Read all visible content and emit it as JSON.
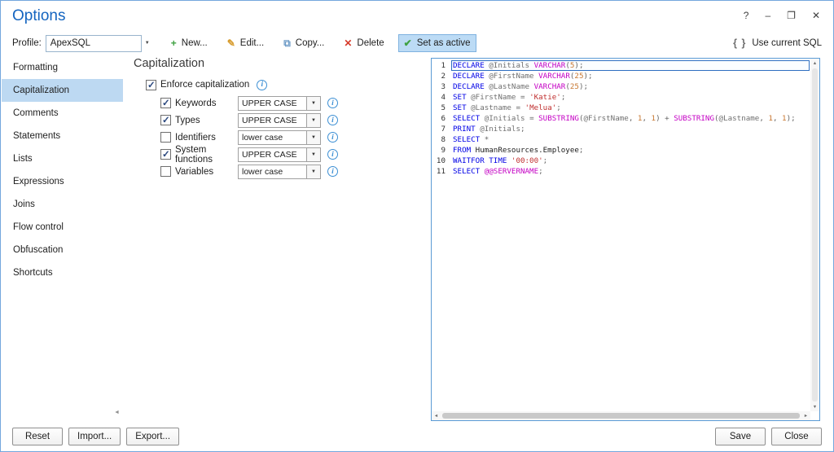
{
  "window": {
    "title": "Options"
  },
  "window_controls": [
    {
      "name": "help",
      "glyph": "?"
    },
    {
      "name": "minimize",
      "glyph": "–"
    },
    {
      "name": "maximize",
      "glyph": "❐"
    },
    {
      "name": "close",
      "glyph": "✕"
    }
  ],
  "icons": {
    "dropdown": "▼",
    "info": "i",
    "scroll_up": "▲",
    "scroll_down": "▼",
    "scroll_left": "◄",
    "scroll_right": "►"
  },
  "toolbar": {
    "profile_label": "Profile:",
    "profile_value": "ApexSQL",
    "buttons": [
      {
        "id": "new",
        "label": "New...",
        "icon": "plus-icon",
        "glyph": "+",
        "color": "#3fa142",
        "active": false
      },
      {
        "id": "edit",
        "label": "Edit...",
        "icon": "pencil-icon",
        "glyph": "✎",
        "color": "#d79b2c",
        "active": false
      },
      {
        "id": "copy",
        "label": "Copy...",
        "icon": "copy-icon",
        "glyph": "⧉",
        "color": "#6d9bc7",
        "active": false
      },
      {
        "id": "delete",
        "label": "Delete",
        "icon": "delete-x-icon",
        "glyph": "✕",
        "color": "#d63a2a",
        "active": false
      },
      {
        "id": "set-as-active",
        "label": "Set as active",
        "icon": "check-icon",
        "glyph": "✔",
        "color": "#3fa142",
        "active": true
      }
    ],
    "use_current_sql": {
      "glyph": "{ }",
      "label": "Use current SQL"
    }
  },
  "sidebar": {
    "items": [
      {
        "label": "Formatting",
        "selected": false
      },
      {
        "label": "Capitalization",
        "selected": true
      },
      {
        "label": "Comments",
        "selected": false
      },
      {
        "label": "Statements",
        "selected": false
      },
      {
        "label": "Lists",
        "selected": false
      },
      {
        "label": "Expressions",
        "selected": false
      },
      {
        "label": "Joins",
        "selected": false
      },
      {
        "label": "Flow control",
        "selected": false
      },
      {
        "label": "Obfuscation",
        "selected": false
      },
      {
        "label": "Shortcuts",
        "selected": false
      }
    ]
  },
  "main": {
    "title": "Capitalization",
    "enforce": {
      "label": "Enforce capitalization",
      "checked": true
    },
    "options": [
      {
        "label": "Keywords",
        "checked": true,
        "value": "UPPER CASE"
      },
      {
        "label": "Types",
        "checked": true,
        "value": "UPPER CASE"
      },
      {
        "label": "Identifiers",
        "checked": false,
        "value": "lower case"
      },
      {
        "label": "System functions",
        "checked": true,
        "value": "UPPER CASE"
      },
      {
        "label": "Variables",
        "checked": false,
        "value": "lower case"
      }
    ]
  },
  "preview": {
    "colors": {
      "keyword": "#0000e6",
      "function": "#c400c4",
      "string": "#c03030",
      "number": "#c87832",
      "variable": "#707070",
      "identifier": "#202020",
      "punct": "#666666"
    },
    "lines": [
      {
        "n": 1,
        "selected": true,
        "tokens": [
          {
            "t": "DECLARE ",
            "c": "k"
          },
          {
            "t": "@Initials ",
            "c": "v"
          },
          {
            "t": "VARCHAR",
            "c": "f"
          },
          {
            "t": "(",
            "c": "p"
          },
          {
            "t": "5",
            "c": "n"
          },
          {
            "t": ");",
            "c": "p"
          }
        ]
      },
      {
        "n": 2,
        "selected": false,
        "tokens": [
          {
            "t": "DECLARE ",
            "c": "k"
          },
          {
            "t": "@FirstName ",
            "c": "v"
          },
          {
            "t": "VARCHAR",
            "c": "f"
          },
          {
            "t": "(",
            "c": "p"
          },
          {
            "t": "25",
            "c": "n"
          },
          {
            "t": ");",
            "c": "p"
          }
        ]
      },
      {
        "n": 3,
        "selected": false,
        "tokens": [
          {
            "t": "DECLARE ",
            "c": "k"
          },
          {
            "t": "@LastName ",
            "c": "v"
          },
          {
            "t": "VARCHAR",
            "c": "f"
          },
          {
            "t": "(",
            "c": "p"
          },
          {
            "t": "25",
            "c": "n"
          },
          {
            "t": ");",
            "c": "p"
          }
        ]
      },
      {
        "n": 4,
        "selected": false,
        "tokens": [
          {
            "t": "SET ",
            "c": "k"
          },
          {
            "t": "@FirstName ",
            "c": "v"
          },
          {
            "t": "= ",
            "c": "p"
          },
          {
            "t": "'Katie'",
            "c": "s"
          },
          {
            "t": ";",
            "c": "p"
          }
        ]
      },
      {
        "n": 5,
        "selected": false,
        "tokens": [
          {
            "t": "SET ",
            "c": "k"
          },
          {
            "t": "@Lastname ",
            "c": "v"
          },
          {
            "t": "= ",
            "c": "p"
          },
          {
            "t": "'Melua'",
            "c": "s"
          },
          {
            "t": ";",
            "c": "p"
          }
        ]
      },
      {
        "n": 6,
        "selected": false,
        "tokens": [
          {
            "t": "SELECT ",
            "c": "k"
          },
          {
            "t": "@Initials ",
            "c": "v"
          },
          {
            "t": "= ",
            "c": "p"
          },
          {
            "t": "SUBSTRING",
            "c": "f"
          },
          {
            "t": "(",
            "c": "p"
          },
          {
            "t": "@FirstName",
            "c": "v"
          },
          {
            "t": ", ",
            "c": "p"
          },
          {
            "t": "1",
            "c": "n"
          },
          {
            "t": ", ",
            "c": "p"
          },
          {
            "t": "1",
            "c": "n"
          },
          {
            "t": ") + ",
            "c": "p"
          },
          {
            "t": "SUBSTRING",
            "c": "f"
          },
          {
            "t": "(",
            "c": "p"
          },
          {
            "t": "@Lastname",
            "c": "v"
          },
          {
            "t": ", ",
            "c": "p"
          },
          {
            "t": "1",
            "c": "n"
          },
          {
            "t": ", ",
            "c": "p"
          },
          {
            "t": "1",
            "c": "n"
          },
          {
            "t": ");",
            "c": "p"
          }
        ]
      },
      {
        "n": 7,
        "selected": false,
        "tokens": [
          {
            "t": "PRINT ",
            "c": "k"
          },
          {
            "t": "@Initials",
            "c": "v"
          },
          {
            "t": ";",
            "c": "p"
          }
        ]
      },
      {
        "n": 8,
        "selected": false,
        "tokens": [
          {
            "t": "SELECT ",
            "c": "k"
          },
          {
            "t": "*",
            "c": "p"
          }
        ]
      },
      {
        "n": 9,
        "selected": false,
        "tokens": [
          {
            "t": "FROM ",
            "c": "k"
          },
          {
            "t": "HumanResources.Employee",
            "c": "i"
          },
          {
            "t": ";",
            "c": "p"
          }
        ]
      },
      {
        "n": 10,
        "selected": false,
        "tokens": [
          {
            "t": "WAITFOR TIME ",
            "c": "k"
          },
          {
            "t": "'00:00'",
            "c": "s"
          },
          {
            "t": ";",
            "c": "p"
          }
        ]
      },
      {
        "n": 11,
        "selected": false,
        "tokens": [
          {
            "t": "SELECT ",
            "c": "k"
          },
          {
            "t": "@@SERVERNAME",
            "c": "f"
          },
          {
            "t": ";",
            "c": "p"
          }
        ]
      }
    ]
  },
  "footer": {
    "left": [
      "Reset",
      "Import...",
      "Export..."
    ],
    "right": [
      "Save",
      "Close"
    ]
  }
}
